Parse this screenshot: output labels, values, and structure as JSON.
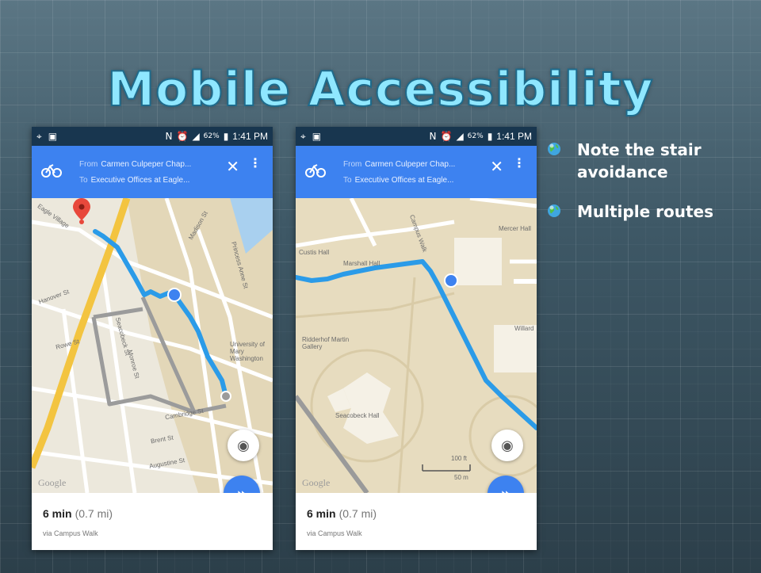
{
  "slide": {
    "title": "Mobile Accessibility",
    "bullets": [
      {
        "text": "Note the stair avoidance",
        "icon": "globe-icon"
      },
      {
        "text": "Multiple routes",
        "icon": "globe-icon"
      }
    ]
  },
  "phones": [
    {
      "status": {
        "time": "1:41 PM",
        "battery": "62%"
      },
      "from_label": "From",
      "from": "Carmen Culpeper Chap...",
      "to_label": "To",
      "to": "Executive Offices at Eagle...",
      "map_labels": {
        "a": "Eagle Village",
        "b": "University of Mary Washington",
        "c": "Cambridge St",
        "d": "Brent St",
        "e": "Augustine St",
        "f": "Seacobeck St",
        "g": "Rowe St",
        "h": "Hanover St",
        "i": "Madison St",
        "j": "Princess Anne St",
        "k": "Monroe St"
      },
      "google": "Google",
      "duration": "6 min",
      "distance": "(0.7 mi)",
      "via": "via Campus Walk"
    },
    {
      "status": {
        "time": "1:41 PM",
        "battery": "62%"
      },
      "from_label": "From",
      "from": "Carmen Culpeper Chap...",
      "to_label": "To",
      "to": "Executive Offices at Eagle...",
      "map_labels": {
        "a": "Mercer Hall",
        "b": "Marshall Hall",
        "c": "Ridderhof Martin Gallery",
        "d": "Seacobeck Hall",
        "e": "Willard",
        "f": "Campus Walk",
        "g": "Custis Hall",
        "h": "100 ft",
        "i": "50 m"
      },
      "google": "Google",
      "duration": "6 min",
      "distance": "(0.7 mi)",
      "via": "via Campus Walk"
    }
  ],
  "colors": {
    "accent": "#3d82f0",
    "route_primary": "#2b9be8",
    "route_alternate": "#9b9b9b",
    "title": "#8fe7ff"
  }
}
